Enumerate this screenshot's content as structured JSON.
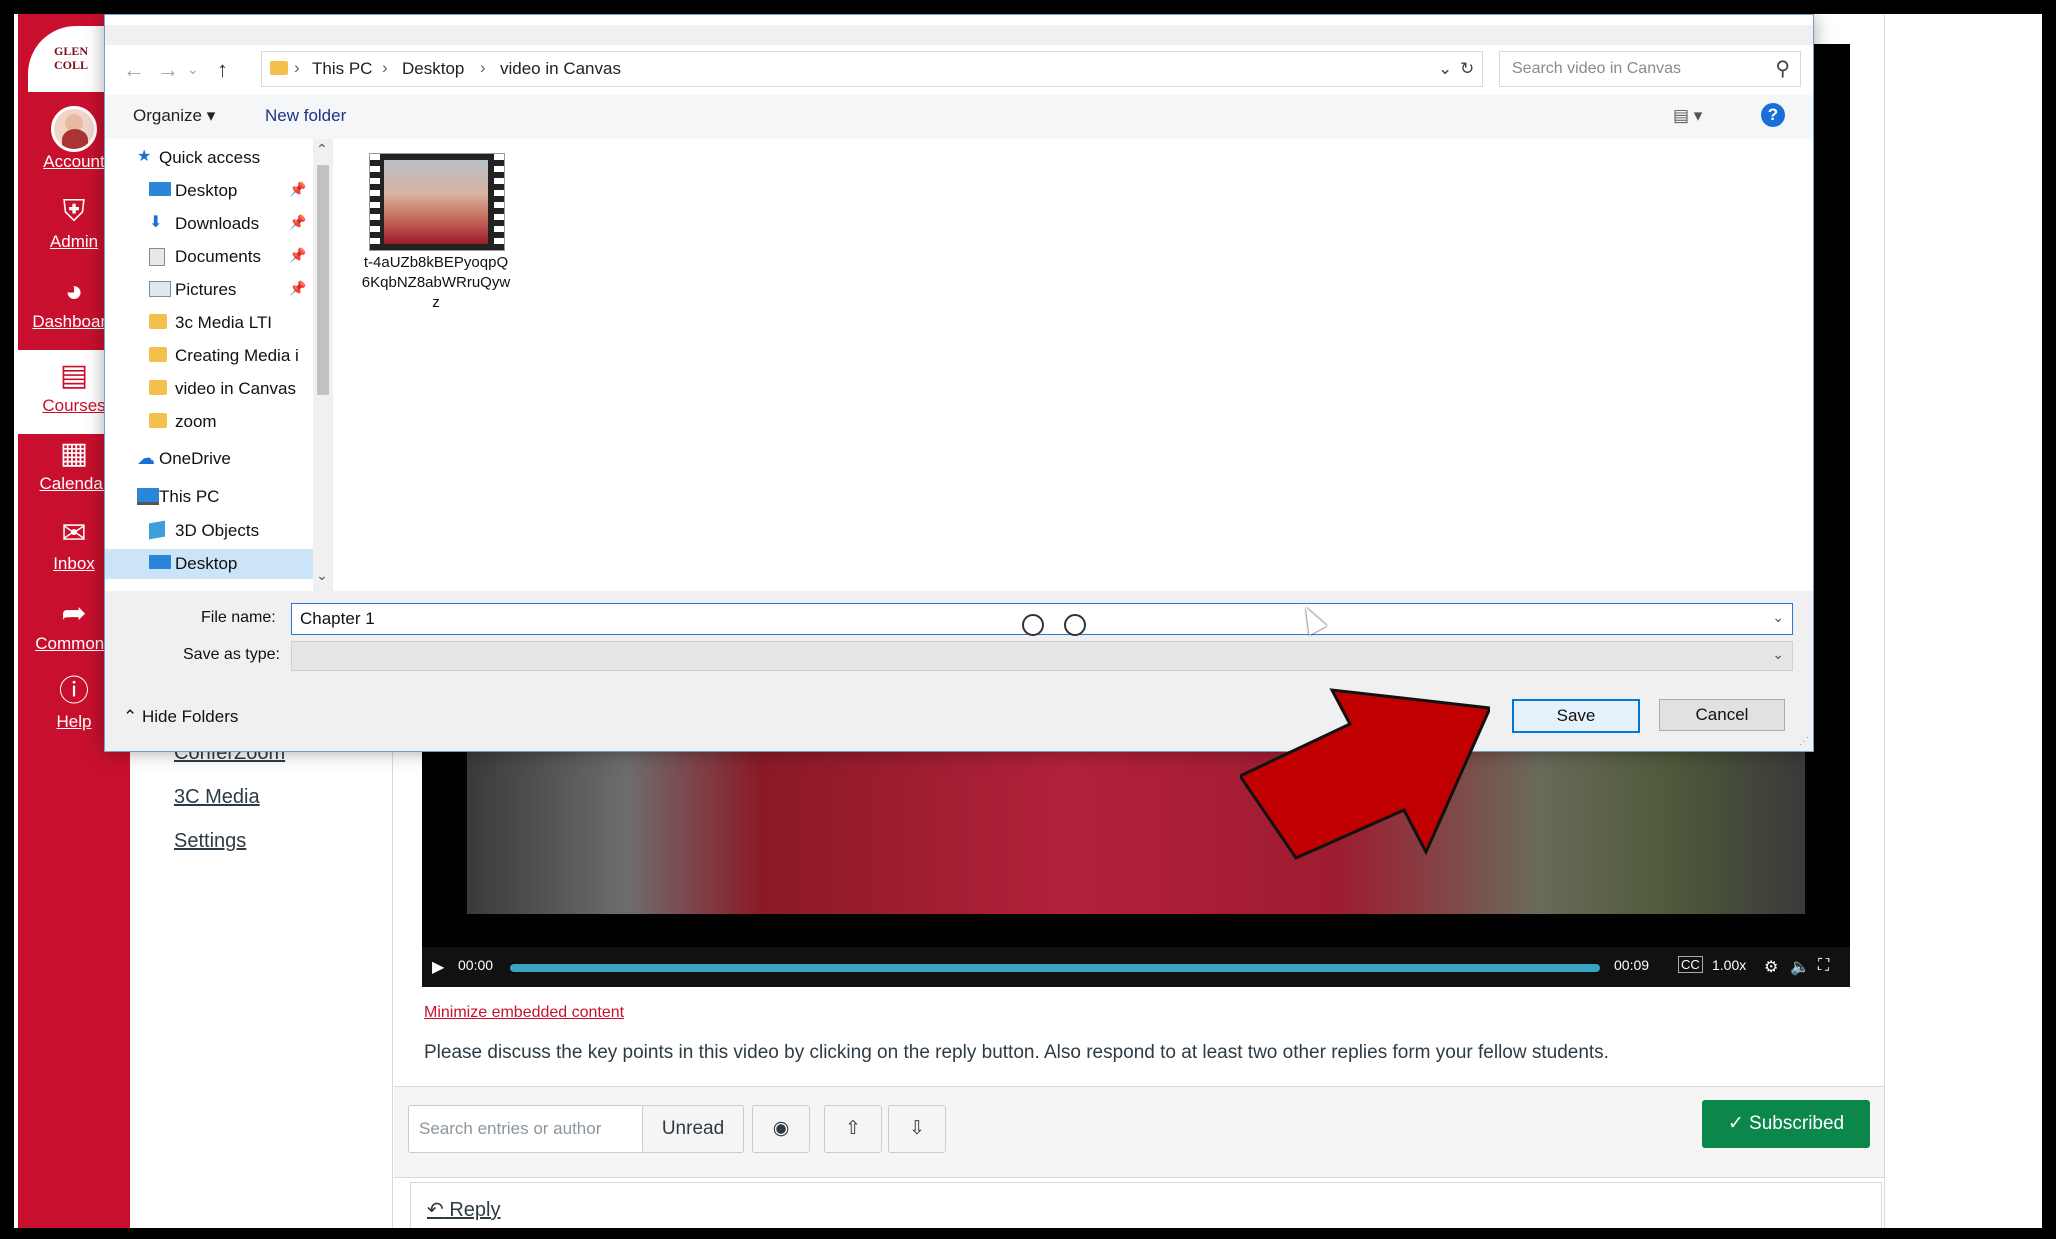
{
  "canvas_nav": {
    "logo_text": "GLEN\nCOLL",
    "items": [
      {
        "label": "Account",
        "icon": "avatar-icon"
      },
      {
        "label": "Admin",
        "icon": "shield-icon"
      },
      {
        "label": "Dashboard",
        "icon": "dashboard-icon"
      },
      {
        "label": "Courses",
        "icon": "book-icon"
      },
      {
        "label": "Calendar",
        "icon": "calendar-icon"
      },
      {
        "label": "Inbox",
        "icon": "inbox-icon"
      },
      {
        "label": "Commons",
        "icon": "commons-icon"
      },
      {
        "label": "Help",
        "icon": "help-icon"
      }
    ]
  },
  "course_nav": [
    "ConferZoom",
    "3C Media",
    "Settings"
  ],
  "video": {
    "time_current": "00:00",
    "time_total": "00:09",
    "speed": "1.00x",
    "progress": 0.0
  },
  "minimize_link": "Minimize embedded content",
  "description": "Please discuss the key points in this video by clicking on the reply button. Also respond to at least two other replies form your fellow students.",
  "discussion_toolbar": {
    "search_placeholder": "Search entries or author",
    "unread_label": "Unread",
    "subscribed_label": "✓ Subscribed"
  },
  "reply_label": "Reply",
  "dialog": {
    "breadcrumb": [
      "This PC",
      "Desktop",
      "video in Canvas"
    ],
    "search_placeholder": "Search video in Canvas",
    "organize_label": "Organize ▾",
    "new_folder_label": "New folder",
    "tree": [
      {
        "label": "Quick access",
        "indent": 0,
        "icon": "star-icon",
        "pinned": false
      },
      {
        "label": "Desktop",
        "indent": 1,
        "icon": "desktop-icon",
        "pinned": true
      },
      {
        "label": "Downloads",
        "indent": 1,
        "icon": "download-icon",
        "pinned": true
      },
      {
        "label": "Documents",
        "indent": 1,
        "icon": "document-icon",
        "pinned": true
      },
      {
        "label": "Pictures",
        "indent": 1,
        "icon": "pictures-icon",
        "pinned": true
      },
      {
        "label": "3c Media LTI",
        "indent": 1,
        "icon": "folder-icon",
        "pinned": false
      },
      {
        "label": "Creating Media i",
        "indent": 1,
        "icon": "folder-icon",
        "pinned": false
      },
      {
        "label": "video in Canvas",
        "indent": 1,
        "icon": "folder-icon",
        "pinned": false
      },
      {
        "label": "zoom",
        "indent": 1,
        "icon": "folder-icon",
        "pinned": false
      },
      {
        "label": "OneDrive",
        "indent": 0,
        "icon": "cloud-icon",
        "pinned": false
      },
      {
        "label": "This PC",
        "indent": 0,
        "icon": "computer-icon",
        "pinned": false
      },
      {
        "label": "3D Objects",
        "indent": 1,
        "icon": "cube-icon",
        "pinned": false
      },
      {
        "label": "Desktop",
        "indent": 1,
        "icon": "desktop-icon",
        "pinned": false
      }
    ],
    "file": {
      "name": "t-4aUZb8kBEPyoqpQ6KqbNZ8abWRruQywz"
    },
    "file_name_label": "File name:",
    "file_name_value": "Chapter 1",
    "save_as_type_label": "Save as type:",
    "hide_folders_label": "Hide Folders",
    "save_label": "Save",
    "cancel_label": "Cancel"
  },
  "colors": {
    "canvas_red": "#c8102e",
    "subscribed_green": "#0b874b",
    "annotation_arrow": "#c00000"
  }
}
